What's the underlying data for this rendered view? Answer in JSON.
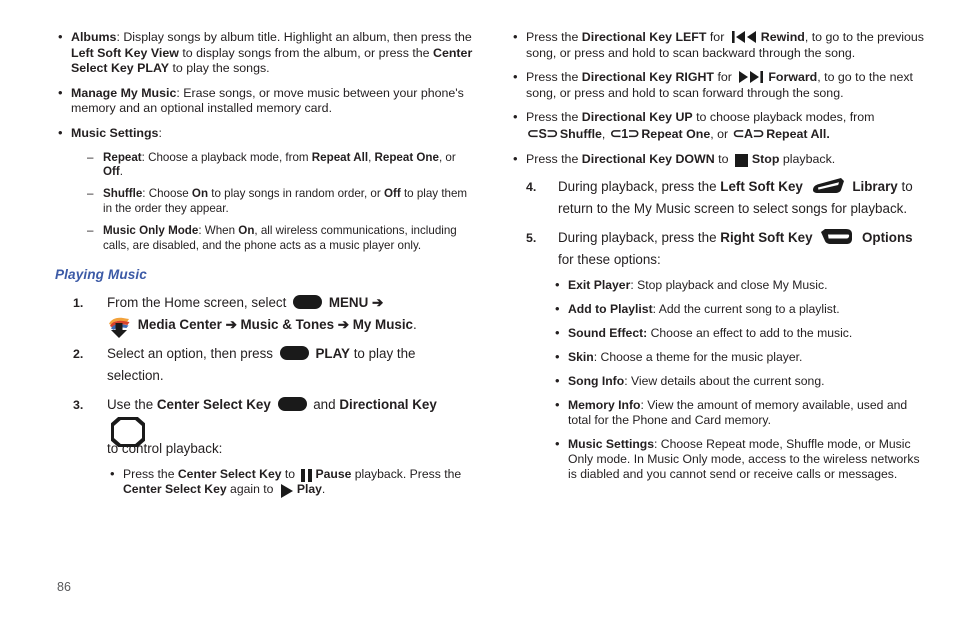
{
  "page": {
    "number": "86",
    "heading_color": "#3c5aa6"
  },
  "left_column": {
    "bullets": [
      {
        "label": "Albums",
        "parts": [
          {
            "t": ": Display songs by album title. Highlight an album, then press the ",
            "b": false
          },
          {
            "t": "Left Soft Key View",
            "b": true
          },
          {
            "t": " to display songs from the album, or press the ",
            "b": false
          },
          {
            "t": "Center Select Key PLAY",
            "b": true
          },
          {
            "t": " to play the songs.",
            "b": false
          }
        ]
      },
      {
        "label": "Manage My Music",
        "parts": [
          {
            "t": ": Erase songs, or move music between your phone's memory and an optional installed memory card.",
            "b": false
          }
        ]
      },
      {
        "label": "Music Settings",
        "parts": [
          {
            "t": ":",
            "b": false
          }
        ]
      }
    ],
    "sub_bullets": [
      {
        "label": "Repeat",
        "parts": [
          {
            "t": ": Choose a playback mode, from ",
            "b": false
          },
          {
            "t": "Repeat All",
            "b": true
          },
          {
            "t": ", ",
            "b": false
          },
          {
            "t": "Repeat One",
            "b": true
          },
          {
            "t": ", or ",
            "b": false
          },
          {
            "t": "Off",
            "b": true
          },
          {
            "t": ".",
            "b": false
          }
        ]
      },
      {
        "label": "Shuffle",
        "parts": [
          {
            "t": ": Choose ",
            "b": false
          },
          {
            "t": "On",
            "b": true
          },
          {
            "t": " to play songs in random order, or ",
            "b": false
          },
          {
            "t": "Off",
            "b": true
          },
          {
            "t": " to play them in the order they appear.",
            "b": false
          }
        ]
      },
      {
        "label": "Music Only Mode",
        "parts": [
          {
            "t": ": When ",
            "b": false
          },
          {
            "t": "On",
            "b": true
          },
          {
            "t": ", all wireless communications, including calls, are disabled, and the phone acts as a music player only.",
            "b": false
          }
        ]
      }
    ],
    "section_title": "Playing Music",
    "steps": {
      "step1": {
        "num": "1.",
        "pre": "From the Home screen, select",
        "menu_label": "MENU",
        "arrow": "➔",
        "path_1": "Media Center",
        "path_2": "Music & Tones",
        "path_3": "My Music",
        "period": "."
      },
      "step2": {
        "num": "2.",
        "pre": "Select an option, then press",
        "play_label": "PLAY",
        "post": "to play the selection."
      },
      "step3": {
        "num": "3.",
        "pre": "Use the",
        "center_key": "Center Select Key",
        "mid": "and",
        "dir_key": "Directional Key",
        "post": "to control playback:",
        "bullet": {
          "p1": "Press the ",
          "center_key": "Center Select Key",
          "p2": " to ",
          "pause": "Pause",
          "p3": " playback. Press the ",
          "center_key2": "Center Select Key",
          "p4": " again to ",
          "play": "Play",
          "p5": "."
        }
      }
    }
  },
  "right_column": {
    "playback_bullets": [
      {
        "p1": "Press the ",
        "key": "Directional Key LEFT",
        "p2": " for ",
        "icon": "rewind-icon",
        "action": "Rewind",
        "p3": ", to go to the previous song, or press and hold to scan backward through the song."
      },
      {
        "p1": "Press the ",
        "key": "Directional Key RIGHT",
        "p2": " for ",
        "icon": "forward-icon",
        "action": "Forward",
        "p3": ", to go to the next song, or press and hold to scan forward through the song."
      }
    ],
    "modes_bullet": {
      "p1": "Press the ",
      "key": "Directional Key UP",
      "p2": " to choose playback modes, from",
      "modes": [
        {
          "glyph": "S",
          "name": "Shuffle",
          "sep": ","
        },
        {
          "glyph": "1",
          "name": "Repeat One",
          "sep": ", or"
        },
        {
          "glyph": "A",
          "name": "Repeat All.",
          "sep": ""
        }
      ]
    },
    "stop_bullet": {
      "p1": "Press the ",
      "key": "Directional Key DOWN",
      "p2": " to ",
      "action": "Stop",
      "p3": " playback."
    },
    "steps": {
      "step4": {
        "num": "4.",
        "pre": "During playback, press the",
        "key": "Left Soft Key",
        "action": "Library",
        "post": "to return to the My Music screen to select songs for playback."
      },
      "step5": {
        "num": "5.",
        "pre": "During playback, press the",
        "key": "Right Soft Key",
        "action": "Options",
        "post": "for these options:"
      }
    },
    "options": [
      {
        "label": "Exit Player",
        "desc": ": Stop playback and close My Music."
      },
      {
        "label": "Add to Playlist",
        "desc": ": Add the current song to a playlist."
      },
      {
        "label": "Sound Effect:",
        "desc": " Choose an effect to add to the music."
      },
      {
        "label": "Skin",
        "desc": ": Choose a theme for the music player."
      },
      {
        "label": "Song Info",
        "desc": ": View details about the current song."
      },
      {
        "label": "Memory Info",
        "desc": ": View the amount of memory available, used and total for the Phone and Card memory."
      },
      {
        "label": "Music Settings",
        "desc": ": Choose Repeat mode, Shuffle mode, or Music Only mode. In Music Only mode, access to the wireless networks is diabled and you cannot send or receive calls or messages."
      }
    ]
  }
}
